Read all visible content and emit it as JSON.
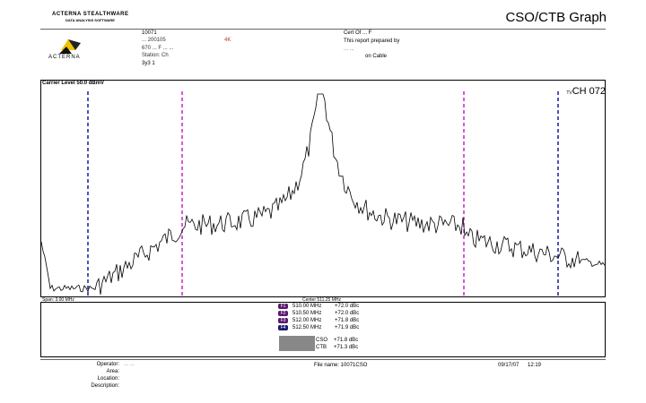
{
  "header": {
    "brand_top": "ACTERNA STEALTHWARE",
    "brand_sub": "DATA ANALYSIS SOFTWARE",
    "title": "CSO/CTB Graph",
    "logo_text": "ACTERNA",
    "report_id": "10071",
    "line2_left": "... 200105",
    "line2_mark": "4K",
    "line3": "670 ... F ... ...",
    "line4": "Station: Ch",
    "line5": "3y3 1",
    "cert_label": "Cert Of ... F",
    "prepared_by": "This report prepared by",
    "prepared_name": "... ...",
    "on_cable": "on Cable"
  },
  "graph": {
    "carrier_level": "Carrier Level 50.0 dBmV",
    "channel_prefix": "TV",
    "channel": "CH 072",
    "span": "Span: 3.00 MHz",
    "center": "Center 511.25 MHz"
  },
  "markers": [
    {
      "id": "F1",
      "freq": "510.00 MHz",
      "level": "+72.0 dBc",
      "color": "#5a1a6e"
    },
    {
      "id": "F2",
      "freq": "510.50 MHz",
      "level": "+72.0 dBc",
      "color": "#5a1a6e"
    },
    {
      "id": "F3",
      "freq": "512.00 MHz",
      "level": "+71.8 dBc",
      "color": "#5a1a6e"
    },
    {
      "id": "F4",
      "freq": "512.50 MHz",
      "level": "+71.9 dBc",
      "color": "#1a1a6e"
    }
  ],
  "results": {
    "cso_label": "CSO",
    "cso_value": "+71.8 dBc",
    "ctb_label": "CTB",
    "ctb_value": "+71.3 dBc"
  },
  "footer": {
    "operator_label": "Operator:",
    "operator_value": "... ...",
    "area_label": "Area:",
    "location_label": "Location:",
    "description_label": "Description:",
    "file_name": "File name: 10071CSO",
    "date": "09/17/07",
    "time": "12:19"
  },
  "colors": {
    "marker_outer": "#1a1a9e",
    "marker_inner": "#cc22cc",
    "trace": "#000000",
    "cso_box": "#888888"
  }
}
